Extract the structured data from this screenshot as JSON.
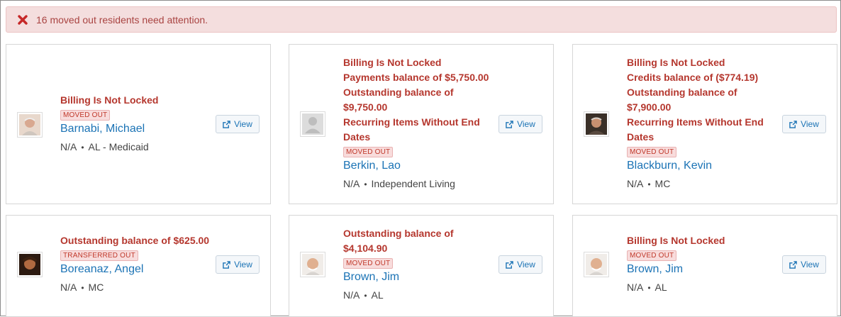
{
  "alert": {
    "message": "16 moved out residents need attention."
  },
  "view_label": "View",
  "meta_separator": "•",
  "cards": [
    {
      "warnings": [
        "Billing Is Not Locked"
      ],
      "badge": "MOVED OUT",
      "name": "Barnabi, Michael",
      "unit": "N/A",
      "care": "AL - Medicaid",
      "avatar": "photo-elderly-man"
    },
    {
      "warnings": [
        "Billing Is Not Locked",
        "Payments balance of $5,750.00",
        "Outstanding balance of",
        "$9,750.00",
        "Recurring Items Without End",
        "Dates"
      ],
      "badge": "MOVED OUT",
      "name": "Berkin, Lao",
      "unit": "N/A",
      "care": "Independent Living",
      "avatar": "placeholder-person"
    },
    {
      "warnings": [
        "Billing Is Not Locked",
        "Credits balance of ($774.19)",
        "Outstanding balance of",
        "$7,900.00",
        "Recurring Items Without End",
        "Dates"
      ],
      "badge": "MOVED OUT",
      "name": "Blackburn, Kevin",
      "unit": "N/A",
      "care": "MC",
      "avatar": "photo-man-dark"
    },
    {
      "warnings": [
        "Outstanding balance of $625.00"
      ],
      "badge": "TRANSFERRED OUT",
      "name": "Boreanaz, Angel",
      "unit": "N/A",
      "care": "MC",
      "avatar": "photo-young-man"
    },
    {
      "warnings": [
        "Outstanding balance of",
        "$4,104.90"
      ],
      "badge": "MOVED OUT",
      "name": "Brown, Jim",
      "unit": "N/A",
      "care": "AL",
      "avatar": "photo-elderly-bald-man"
    },
    {
      "warnings": [
        "Billing Is Not Locked"
      ],
      "badge": "MOVED OUT",
      "name": "Brown, Jim",
      "unit": "N/A",
      "care": "AL",
      "avatar": "photo-elderly-bald-man"
    }
  ],
  "colors": {
    "warning_text": "#b5372e",
    "link": "#1b73b5",
    "alert_bg": "#f4dede",
    "alert_text": "#a94442"
  }
}
